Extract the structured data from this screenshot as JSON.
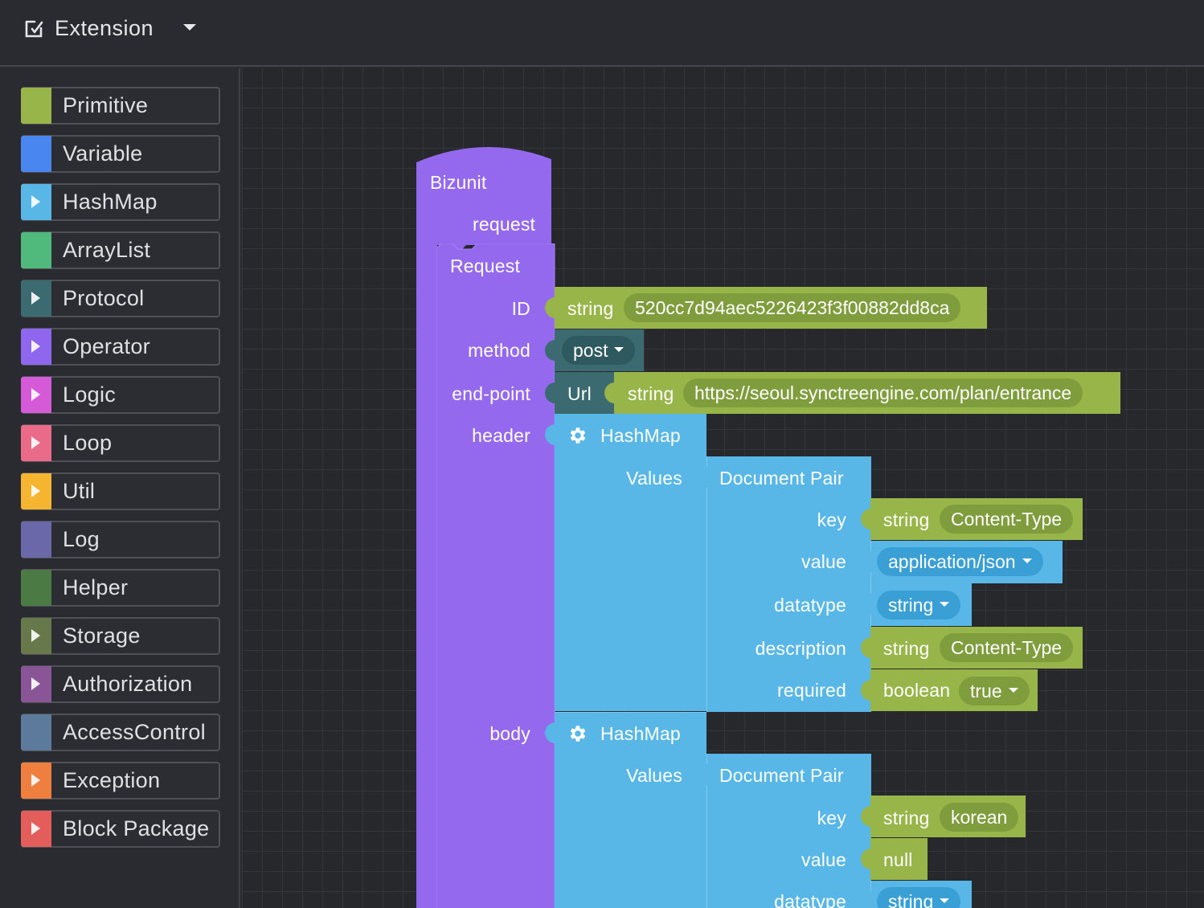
{
  "header": {
    "title": "Extension"
  },
  "sidebar": {
    "items": [
      {
        "label": "Primitive",
        "color": "#97b548",
        "arrow": false
      },
      {
        "label": "Variable",
        "color": "#4a86f0",
        "arrow": false
      },
      {
        "label": "HashMap",
        "color": "#58b7e6",
        "arrow": true
      },
      {
        "label": "ArrayList",
        "color": "#4fba7c",
        "arrow": false
      },
      {
        "label": "Protocol",
        "color": "#3b6b70",
        "arrow": true
      },
      {
        "label": "Operator",
        "color": "#8f66ee",
        "arrow": true
      },
      {
        "label": "Logic",
        "color": "#d55ad8",
        "arrow": true
      },
      {
        "label": "Loop",
        "color": "#ea6a8a",
        "arrow": true
      },
      {
        "label": "Util",
        "color": "#f5b531",
        "arrow": true
      },
      {
        "label": "Log",
        "color": "#6a68a8",
        "arrow": false
      },
      {
        "label": "Helper",
        "color": "#4c7a45",
        "arrow": false
      },
      {
        "label": "Storage",
        "color": "#67784a",
        "arrow": true
      },
      {
        "label": "Authorization",
        "color": "#8a5596",
        "arrow": true
      },
      {
        "label": "AccessControl",
        "color": "#5c7a9c",
        "arrow": false
      },
      {
        "label": "Exception",
        "color": "#ef7f3f",
        "arrow": true
      },
      {
        "label": "Block Package",
        "color": "#e35d5b",
        "arrow": true
      }
    ]
  },
  "canvas": {
    "bizunit": {
      "title": "Bizunit",
      "request_label": "request"
    },
    "request": {
      "title": "Request",
      "id_label": "ID",
      "method_label": "method",
      "endpoint_label": "end-point",
      "header_label": "header",
      "body_label": "body"
    },
    "id_block": {
      "type": "string",
      "value": "520cc7d94aec5226423f3f00882dd8ca"
    },
    "method_block": {
      "value": "post"
    },
    "endpoint_block": {
      "url_label": "Url",
      "type": "string",
      "value": "https://seoul.synctreengine.com/plan/entrance"
    },
    "header_hashmap": {
      "title": "HashMap",
      "values_label": "Values",
      "pair": {
        "title": "Document Pair",
        "key_label": "key",
        "key_type": "string",
        "key_value": "Content-Type",
        "value_label": "value",
        "value_value": "application/json",
        "datatype_label": "datatype",
        "datatype_value": "string",
        "description_label": "description",
        "description_type": "string",
        "description_value": "Content-Type",
        "required_label": "required",
        "required_type": "boolean",
        "required_value": "true"
      }
    },
    "body_hashmap": {
      "title": "HashMap",
      "values_label": "Values",
      "pair": {
        "title": "Document Pair",
        "key_label": "key",
        "key_type": "string",
        "key_value": "korean",
        "value_label": "value",
        "value_value": "null",
        "datatype_label": "datatype",
        "datatype_value": "string"
      }
    }
  }
}
